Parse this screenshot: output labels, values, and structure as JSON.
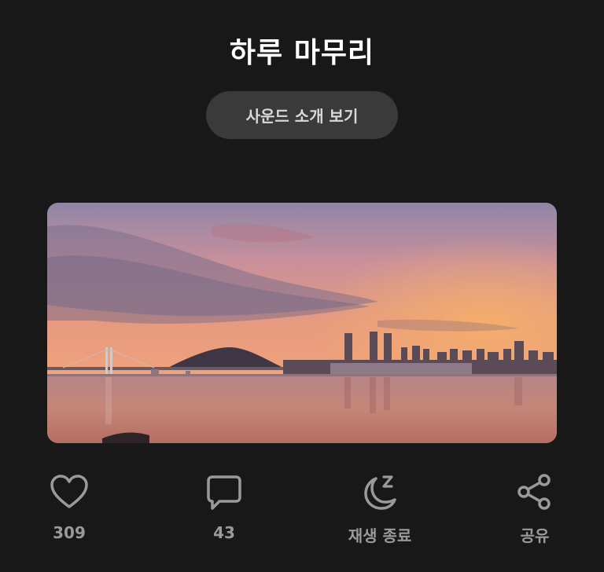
{
  "header": {
    "title": "하루 마무리",
    "sound_intro_label": "사운드 소개 보기"
  },
  "hero": {
    "image": "sunset-city-bay-photo"
  },
  "actions": [
    {
      "icon": "heart-icon",
      "label": "309"
    },
    {
      "icon": "comment-icon",
      "label": "43"
    },
    {
      "icon": "sleep-moon-icon",
      "label": "재생 종료"
    },
    {
      "icon": "share-icon",
      "label": "공유"
    }
  ],
  "colors": {
    "background": "#181818",
    "button_bg": "#3a3a3a",
    "icon_gray": "#9a9a9a"
  }
}
